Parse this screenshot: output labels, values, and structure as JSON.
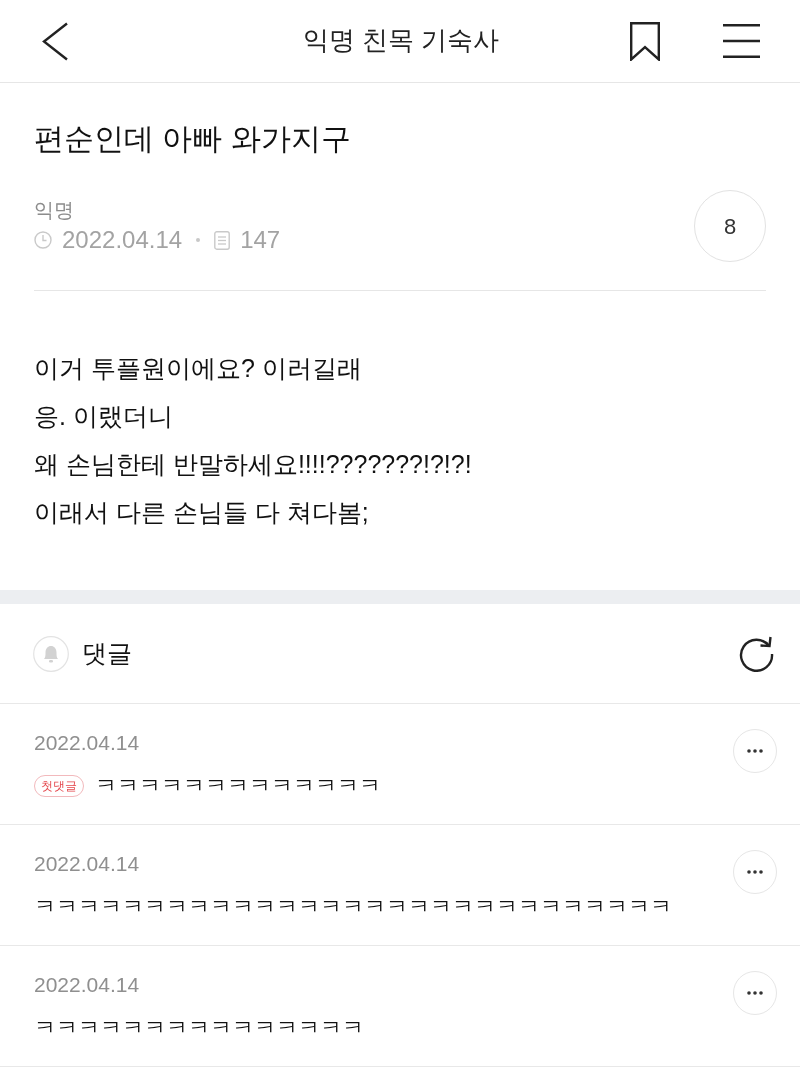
{
  "header": {
    "title": "익명 친목 기숙사"
  },
  "post": {
    "title": "편순인데 아빠 와가지구",
    "author": "익명",
    "date": "2022.04.14",
    "views": "147",
    "comment_count": "8",
    "body": [
      "이거 투플원이에요? 이러길래",
      "응. 이랬더니",
      "왜 손님한테 반말하세요!!!!???????!?!?!",
      "이래서 다른 손님들 다 쳐다봄;"
    ]
  },
  "comment_section": {
    "title": "댓글"
  },
  "comments": [
    {
      "date": "2022.04.14",
      "badge": "첫댓글",
      "text": "ㅋㅋㅋㅋㅋㅋㅋㅋㅋㅋㅋㅋㅋ"
    },
    {
      "date": "2022.04.14",
      "text": "ㅋㅋㅋㅋㅋㅋㅋㅋㅋㅋㅋㅋㅋㅋㅋㅋㅋㅋㅋㅋㅋㅋㅋㅋㅋㅋㅋㅋㅋ"
    },
    {
      "date": "2022.04.14",
      "text": "ㅋㅋㅋㅋㅋㅋㅋㅋㅋㅋㅋㅋㅋㅋㅋ"
    }
  ]
}
